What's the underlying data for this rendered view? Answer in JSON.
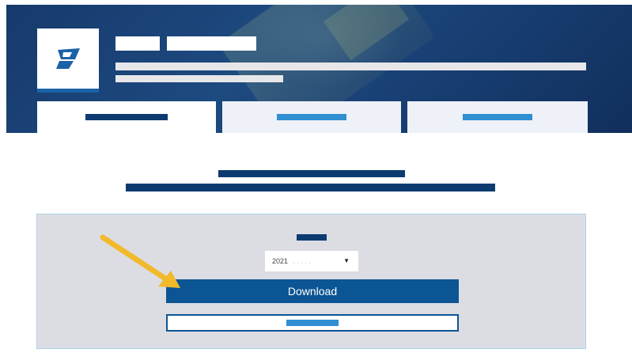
{
  "colors": {
    "brand_navy": "#0d3b70",
    "tab_accent": "#2f8fd2",
    "button_blue": "#0c5594",
    "arrow_yellow": "#f2b92b"
  },
  "header": {
    "logo_icon": "flag-logo-icon",
    "tabs": [
      {
        "state": "active"
      },
      {
        "state": "inactive"
      },
      {
        "state": "inactive"
      }
    ]
  },
  "download_panel": {
    "year_select": {
      "selected_value": "2021",
      "caret_icon": "triangle-down-icon"
    },
    "download_label": "Download"
  },
  "annotation": {
    "icon": "yellow-arrow-icon"
  }
}
